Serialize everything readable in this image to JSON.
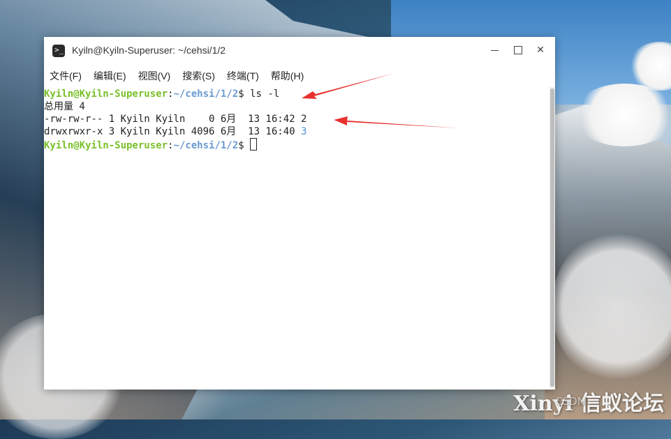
{
  "window": {
    "title": "Kyiln@Kyiln-Superuser: ~/cehsi/1/2",
    "controls": {
      "minimize": "minimize",
      "maximize": "maximize",
      "close": "✕"
    }
  },
  "menubar": [
    {
      "label": "文件(F)"
    },
    {
      "label": "编辑(E)"
    },
    {
      "label": "视图(V)"
    },
    {
      "label": "搜索(S)"
    },
    {
      "label": "终端(T)"
    },
    {
      "label": "帮助(H)"
    }
  ],
  "terminal": {
    "prompt_user": "Kyiln@Kyiln-Superuser",
    "prompt_sep": ":",
    "prompt_path": "~/cehsi/1/2",
    "prompt_symbol": "$ ",
    "command": "ls -l",
    "total_line": "总用量 4",
    "file_row_prefix": "-rw-rw-r-- 1 Kyiln Kyiln    0 6月  13 16:42 ",
    "file_row_name": "2",
    "dir_row_prefix": "drwxrwxr-x 3 Kyiln Kyiln 4096 6月  13 16:40 ",
    "dir_row_name": "3"
  },
  "watermark": {
    "brand": "Xinyi 信蚁论坛",
    "faint": "CSDN"
  },
  "colors": {
    "prompt_user": "#7ac02a",
    "prompt_path": "#6a9ad0",
    "dir_name": "#4f8fcf",
    "arrow": "#e8312e"
  }
}
